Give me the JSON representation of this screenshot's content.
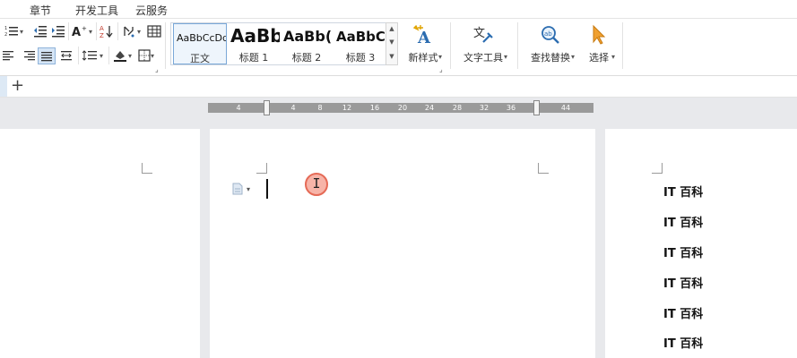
{
  "menu_tabs": [
    "章节",
    "开发工具",
    "云服务"
  ],
  "styles": {
    "items": [
      {
        "sample": "AaBbCcDd",
        "name": "正文"
      },
      {
        "sample": "AaBb",
        "name": "标题 1"
      },
      {
        "sample": "AaBb(",
        "name": "标题 2"
      },
      {
        "sample": "AaBbC",
        "name": "标题 3"
      }
    ]
  },
  "buttons": {
    "new_style": "新样式",
    "text_tools": "文字工具",
    "find_replace": "查找替换",
    "select": "选择"
  },
  "tab_bar": {
    "plus": "+"
  },
  "ruler": {
    "numbers": [
      "4",
      "4",
      "8",
      "12",
      "16",
      "20",
      "24",
      "28",
      "32",
      "36",
      "44"
    ]
  },
  "right_page": {
    "lines": [
      "IT 百科",
      "IT 百科",
      "IT 百科",
      "IT 百科",
      "IT 百科",
      "IT 百科"
    ]
  },
  "colors": {
    "accent": "#2b579a",
    "ruler": "#9a9a9a",
    "workspace": "#e8e9ec",
    "highlight_ring": "#e56a56"
  }
}
